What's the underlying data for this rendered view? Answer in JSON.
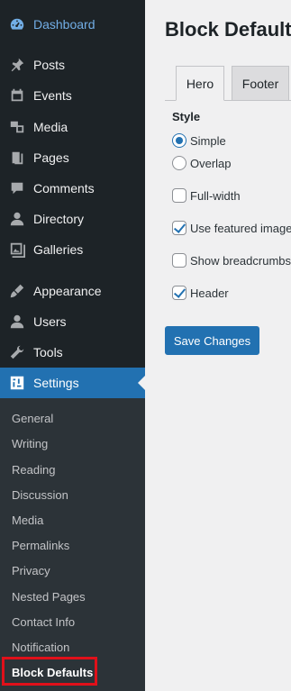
{
  "sidebar": {
    "items": [
      {
        "label": "Dashboard",
        "icon": "dashboard-icon"
      },
      {
        "label": "Posts",
        "icon": "pin-icon"
      },
      {
        "label": "Events",
        "icon": "calendar-icon"
      },
      {
        "label": "Media",
        "icon": "media-icon"
      },
      {
        "label": "Pages",
        "icon": "pages-icon"
      },
      {
        "label": "Comments",
        "icon": "comment-icon"
      },
      {
        "label": "Directory",
        "icon": "user-icon"
      },
      {
        "label": "Galleries",
        "icon": "gallery-icon"
      },
      {
        "label": "Appearance",
        "icon": "brush-icon"
      },
      {
        "label": "Users",
        "icon": "user-icon"
      },
      {
        "label": "Tools",
        "icon": "wrench-icon"
      },
      {
        "label": "Settings",
        "icon": "settings-icon"
      }
    ],
    "submenu": [
      "General",
      "Writing",
      "Reading",
      "Discussion",
      "Media",
      "Permalinks",
      "Privacy",
      "Nested Pages",
      "Contact Info",
      "Notification",
      "Block Defaults"
    ]
  },
  "main": {
    "title": "Block Defaults",
    "tabs": [
      "Hero",
      "Footer"
    ],
    "style_label": "Style",
    "radios": [
      {
        "label": "Simple",
        "checked": true
      },
      {
        "label": "Overlap",
        "checked": false
      }
    ],
    "checkboxes": [
      {
        "label": "Full-width",
        "checked": false
      },
      {
        "label": "Use featured image",
        "checked": true
      },
      {
        "label": "Show breadcrumbs",
        "checked": false
      },
      {
        "label": "Header",
        "checked": true
      }
    ],
    "save_label": "Save Changes"
  },
  "colors": {
    "sidebar_bg": "#1d2327",
    "accent": "#2271b1",
    "highlight": "#e0101a"
  }
}
